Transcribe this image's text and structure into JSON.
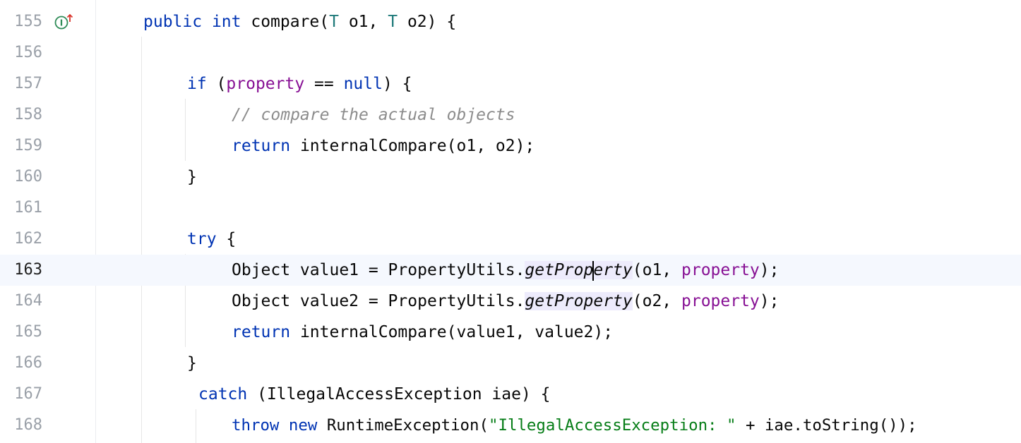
{
  "colors": {
    "keyword": "#0033b3",
    "type_param": "#1f7a7a",
    "field": "#871094",
    "comment": "#8c8c8c",
    "string": "#067d17",
    "text": "#080808",
    "line_number": "#9aa0a8",
    "current_line_bg": "#f5f8fe",
    "usage_highlight": "#edebfc",
    "gutter_icon": "#2e8b57",
    "gutter_arrow": "#d9342b"
  },
  "gutter_icon": "implements-method-icon",
  "lines": [
    {
      "n": "155",
      "tokens": [
        "public",
        " ",
        "int",
        " compare(",
        "T",
        " o1, ",
        "T",
        " o2) {"
      ]
    },
    {
      "n": "156"
    },
    {
      "n": "157",
      "tokens": [
        "if",
        " (",
        "property",
        " == ",
        "null",
        ") {"
      ]
    },
    {
      "n": "158",
      "tokens": [
        "// compare the actual objects"
      ]
    },
    {
      "n": "159",
      "tokens": [
        "return",
        " internalCompare(o1, o2);"
      ]
    },
    {
      "n": "160",
      "tokens": [
        "}"
      ]
    },
    {
      "n": "161"
    },
    {
      "n": "162",
      "tokens": [
        "try",
        " {"
      ]
    },
    {
      "n": "163",
      "tokens": [
        "Object value1 = PropertyUtils.",
        "getProp",
        "erty",
        "(o1, ",
        "property",
        ");"
      ]
    },
    {
      "n": "164",
      "tokens": [
        "Object value2 = PropertyUtils.",
        "getProperty",
        "(o2, ",
        "property",
        ");"
      ]
    },
    {
      "n": "165",
      "tokens": [
        "return",
        " internalCompare(value1, value2);"
      ]
    },
    {
      "n": "166",
      "tokens": [
        "}"
      ]
    },
    {
      "n": "167",
      "tokens": [
        "catch",
        " (IllegalAccessException iae) {"
      ]
    },
    {
      "n": "168",
      "tokens": [
        "throw",
        " ",
        "new",
        " RuntimeException(",
        "\"IllegalAccessException: \"",
        " + iae.toString());"
      ]
    }
  ]
}
